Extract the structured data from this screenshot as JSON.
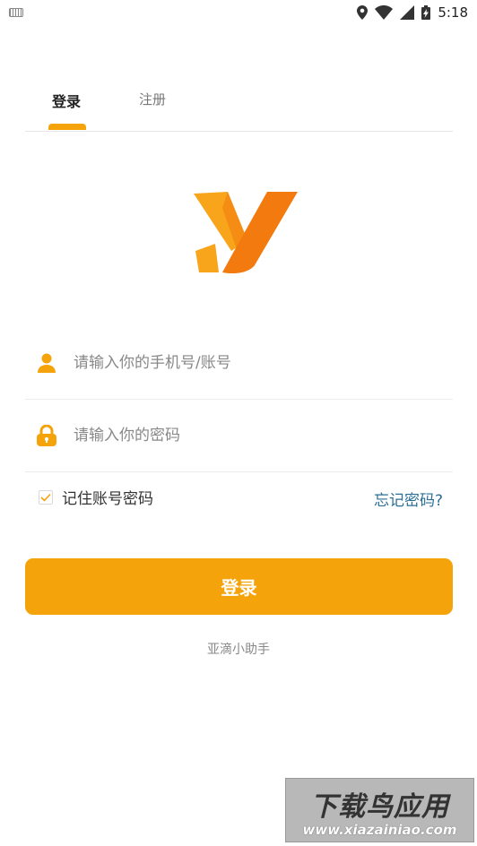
{
  "status_bar": {
    "time": "5:18"
  },
  "tabs": {
    "login": "登录",
    "register": "注册"
  },
  "form": {
    "phone_placeholder": "请输入你的手机号/账号",
    "password_placeholder": "请输入你的密码",
    "remember_label": "记住账号密码",
    "remember_checked": true,
    "forgot_label": "忘记密码?",
    "submit_label": "登录"
  },
  "footer": {
    "text": "亚滴小助手"
  },
  "watermark": {
    "title": "下载鸟应用",
    "url": "www.xiazainiao.com"
  },
  "colors": {
    "accent": "#f5a30a",
    "link": "#2b6f96",
    "logo_orange": "#f27a0e",
    "logo_yellow": "#f8a51b"
  }
}
